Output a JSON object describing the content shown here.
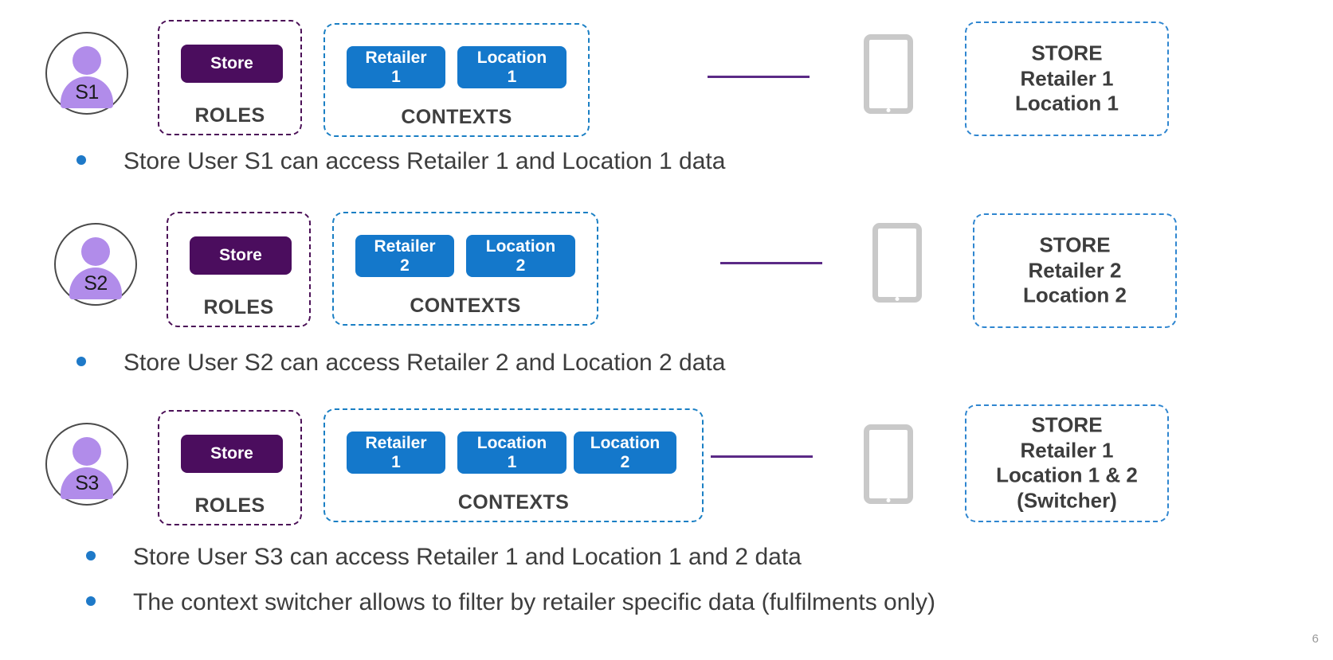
{
  "slide": {
    "page_number": "6"
  },
  "rows": [
    {
      "avatar": {
        "label": "S1",
        "icon": "person-icon"
      },
      "roles": {
        "caption": "ROLES",
        "chips": [
          {
            "label": "Store"
          }
        ]
      },
      "contexts": {
        "caption": "CONTEXTS",
        "chips": [
          {
            "line1": "Retailer",
            "line2": "1"
          },
          {
            "line1": "Location",
            "line2": "1"
          }
        ]
      },
      "device": {
        "icon": "tablet-icon"
      },
      "store": {
        "title": "STORE",
        "line2": "Retailer 1",
        "line3": "Location 1",
        "line4": ""
      }
    },
    {
      "avatar": {
        "label": "S2",
        "icon": "person-icon"
      },
      "roles": {
        "caption": "ROLES",
        "chips": [
          {
            "label": "Store"
          }
        ]
      },
      "contexts": {
        "caption": "CONTEXTS",
        "chips": [
          {
            "line1": "Retailer",
            "line2": "2"
          },
          {
            "line1": "Location",
            "line2": "2"
          }
        ]
      },
      "device": {
        "icon": "tablet-icon"
      },
      "store": {
        "title": "STORE",
        "line2": "Retailer 2",
        "line3": "Location 2",
        "line4": ""
      }
    },
    {
      "avatar": {
        "label": "S3",
        "icon": "person-icon"
      },
      "roles": {
        "caption": "ROLES",
        "chips": [
          {
            "label": "Store"
          }
        ]
      },
      "contexts": {
        "caption": "CONTEXTS",
        "chips": [
          {
            "line1": "Retailer",
            "line2": "1"
          },
          {
            "line1": "Location",
            "line2": "1"
          },
          {
            "line1": "Location",
            "line2": "2"
          }
        ]
      },
      "device": {
        "icon": "tablet-icon"
      },
      "store": {
        "title": "STORE",
        "line2": "Retailer 1",
        "line3": "Location 1 & 2",
        "line4": "(Switcher)"
      }
    }
  ],
  "bullets": [
    {
      "text": "Store User S1 can access Retailer 1 and Location 1 data"
    },
    {
      "text": "Store User S2 can access Retailer 2 and Location 2 data"
    },
    {
      "text": "Store User S3 can access Retailer 1 and Location 1 and 2 data"
    },
    {
      "text": "The context switcher allows to filter by retailer specific data (fulfilments only)"
    }
  ],
  "colors": {
    "role_chip": "#4b0d5e",
    "context_chip": "#1478cb",
    "avatar_fill": "#b18cea",
    "connector": "#5b2a86",
    "bullet_dot": "#1e79c8",
    "contexts_border": "#1a7fc4",
    "roles_border": "#4b1057",
    "store_border": "#2f86d0",
    "device": "#c9c9c9"
  }
}
